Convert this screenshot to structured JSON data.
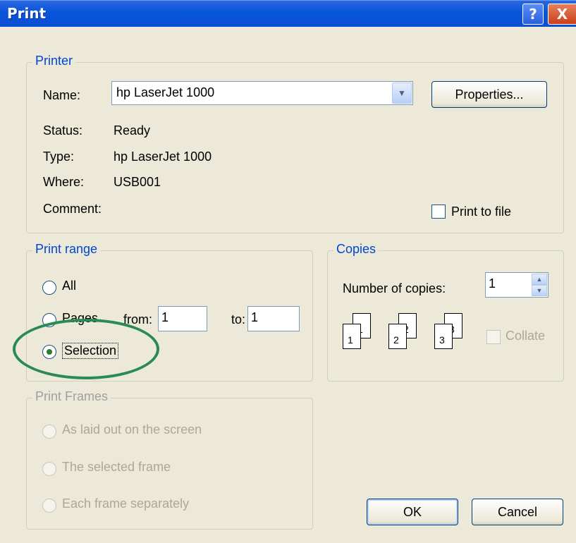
{
  "window": {
    "title": "Print",
    "help_glyph": "?",
    "close_glyph": "X"
  },
  "printer": {
    "legend": "Printer",
    "name_label": "Name:",
    "name_value": "hp LaserJet 1000",
    "properties_button": "Properties...",
    "status_label": "Status:",
    "status_value": "Ready",
    "type_label": "Type:",
    "type_value": "hp LaserJet 1000",
    "where_label": "Where:",
    "where_value": "USB001",
    "comment_label": "Comment:",
    "print_to_file_label": "Print to file",
    "print_to_file_checked": false
  },
  "print_range": {
    "legend": "Print range",
    "all_label": "All",
    "pages_label": "Pages",
    "from_label": "from:",
    "from_value": "1",
    "to_label": "to:",
    "to_value": "1",
    "selection_label": "Selection",
    "selected": "Selection"
  },
  "copies": {
    "legend": "Copies",
    "number_label": "Number of copies:",
    "number_value": "1",
    "collate_label": "Collate",
    "collate_enabled": false,
    "pages_numbers": [
      "1",
      "1",
      "2",
      "2",
      "3",
      "3"
    ]
  },
  "print_frames": {
    "legend": "Print Frames",
    "options": [
      "As laid out on the screen",
      "The selected frame",
      "Each frame separately"
    ],
    "enabled": false
  },
  "buttons": {
    "ok": "OK",
    "cancel": "Cancel"
  },
  "colors": {
    "titlebar": "#0855dd",
    "legend": "#0046d5",
    "dialog_bg": "#ECE9D8",
    "highlight_circle": "#2a8a52"
  },
  "icons": {
    "combo_dropdown": "chevron-down-icon",
    "spin": "spin-arrows-icon"
  }
}
